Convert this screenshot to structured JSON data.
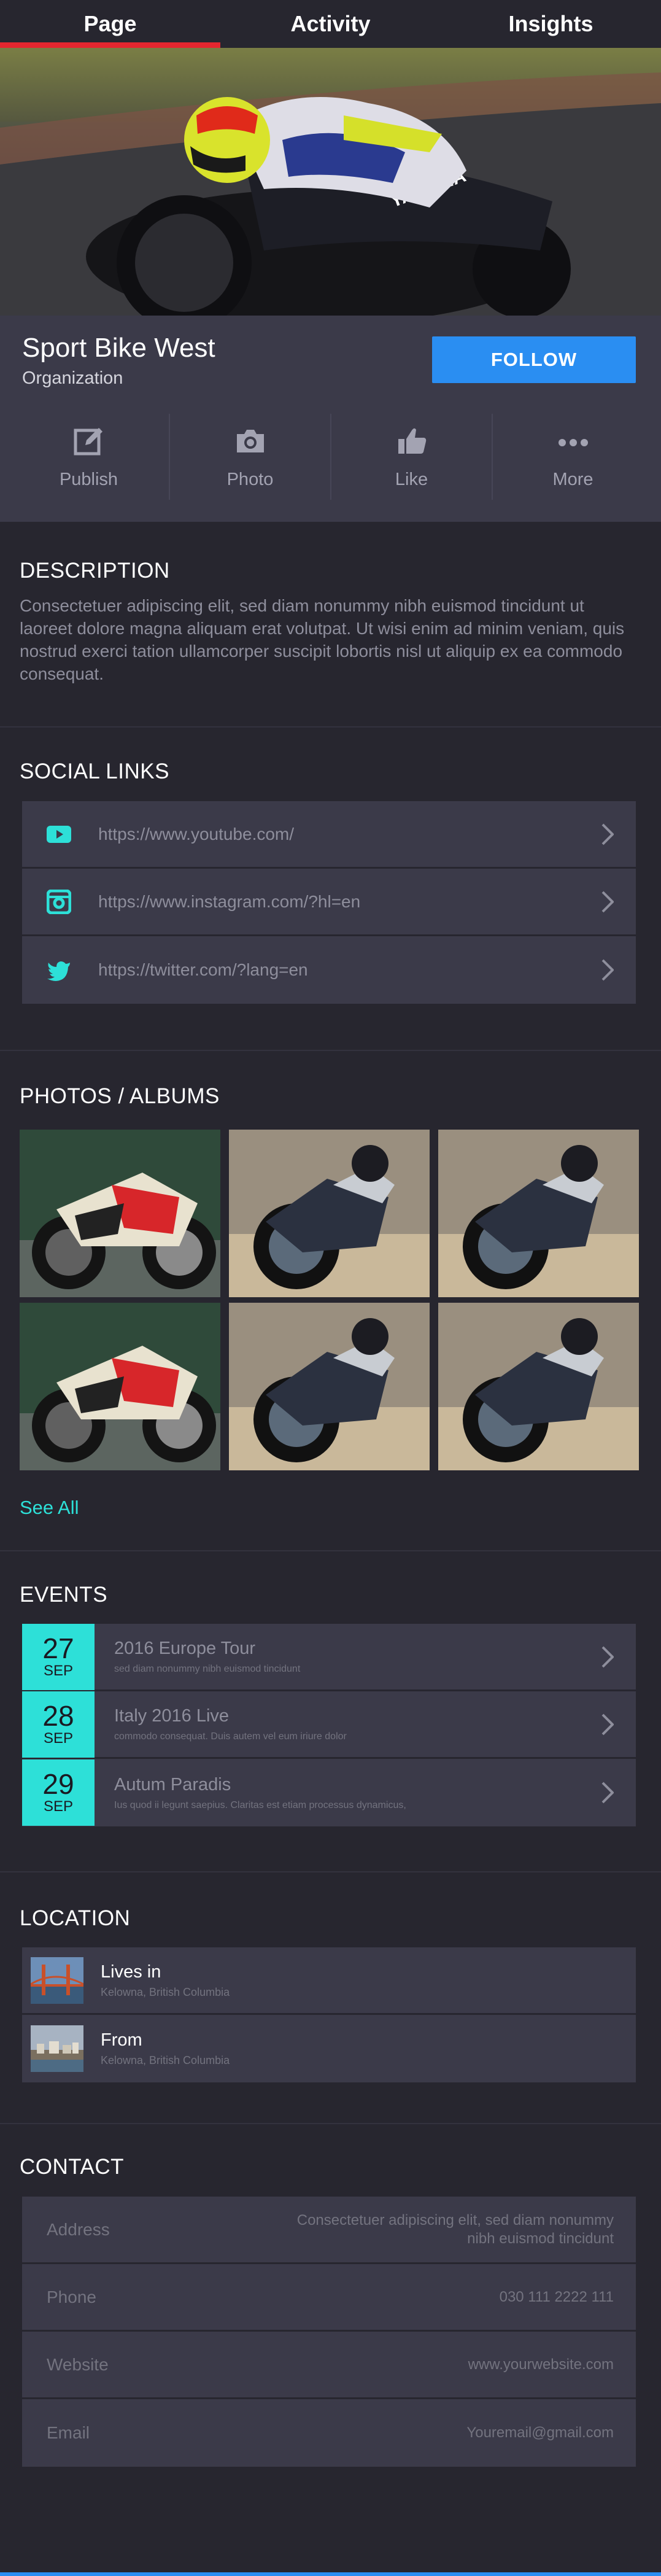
{
  "tabs": [
    {
      "label": "Page",
      "active": true
    },
    {
      "label": "Activity",
      "active": false
    },
    {
      "label": "Insights",
      "active": false
    }
  ],
  "profile": {
    "name": "Sport Bike West",
    "type": "Organization",
    "follow_label": "FOLLOW",
    "actions": [
      {
        "label": "Publish",
        "icon": "edit-icon"
      },
      {
        "label": "Photo",
        "icon": "camera-icon"
      },
      {
        "label": "Like",
        "icon": "thumbs-up-icon"
      },
      {
        "label": "More",
        "icon": "more-icon"
      }
    ]
  },
  "description": {
    "title": "DESCRIPTION",
    "text": "Consectetuer adipiscing elit, sed diam nonummy nibh euismod tincidunt ut laoreet dolore magna aliquam erat volutpat. Ut wisi enim ad minim veniam, quis nostrud exerci tation ullamcorper suscipit lobortis nisl ut aliquip ex ea commodo consequat."
  },
  "social": {
    "title": "SOCIAL LINKS",
    "links": [
      {
        "icon": "youtube-icon",
        "url": "https://www.youtube.com/"
      },
      {
        "icon": "instagram-icon",
        "url": "https://www.instagram.com/?hl=en"
      },
      {
        "icon": "twitter-icon",
        "url": "https://twitter.com/?lang=en"
      }
    ]
  },
  "photos": {
    "title": "PHOTOS / ALBUMS",
    "see_all": "See All"
  },
  "events": {
    "title": "EVENTS",
    "items": [
      {
        "day": "27",
        "month": "SEP",
        "title": "2016 Europe Tour",
        "subtitle": "sed diam nonummy nibh euismod tincidunt"
      },
      {
        "day": "28",
        "month": "SEP",
        "title": "Italy 2016 Live",
        "subtitle": "commodo consequat. Duis autem vel eum iriure dolor"
      },
      {
        "day": "29",
        "month": "SEP",
        "title": "Autum Paradis",
        "subtitle": "Ius quod ii legunt saepius. Claritas est etiam processus dynamicus,"
      }
    ]
  },
  "location": {
    "title": "LOCATION",
    "items": [
      {
        "title": "Lives in",
        "subtitle": "Kelowna, British Columbia"
      },
      {
        "title": "From",
        "subtitle": "Kelowna, British Columbia"
      }
    ]
  },
  "contact": {
    "title": "CONTACT",
    "items": [
      {
        "label": "Address",
        "value_line1": "Consectetuer adipiscing elit, sed diam nonummy",
        "value_line2": "nibh euismod tincidunt"
      },
      {
        "label": "Phone",
        "value_line1": "030 111 2222 111",
        "value_line2": ""
      },
      {
        "label": "Website",
        "value_line1": "www.yourwebsite.com",
        "value_line2": ""
      },
      {
        "label": "Email",
        "value_line1": "Youremail@gmail.com",
        "value_line2": ""
      }
    ]
  },
  "colors": {
    "background": "#27262f",
    "panel": "#3b3a49",
    "accent_red": "#e5262f",
    "accent_blue": "#2a8ef2",
    "accent_cyan": "#2de0d8"
  }
}
